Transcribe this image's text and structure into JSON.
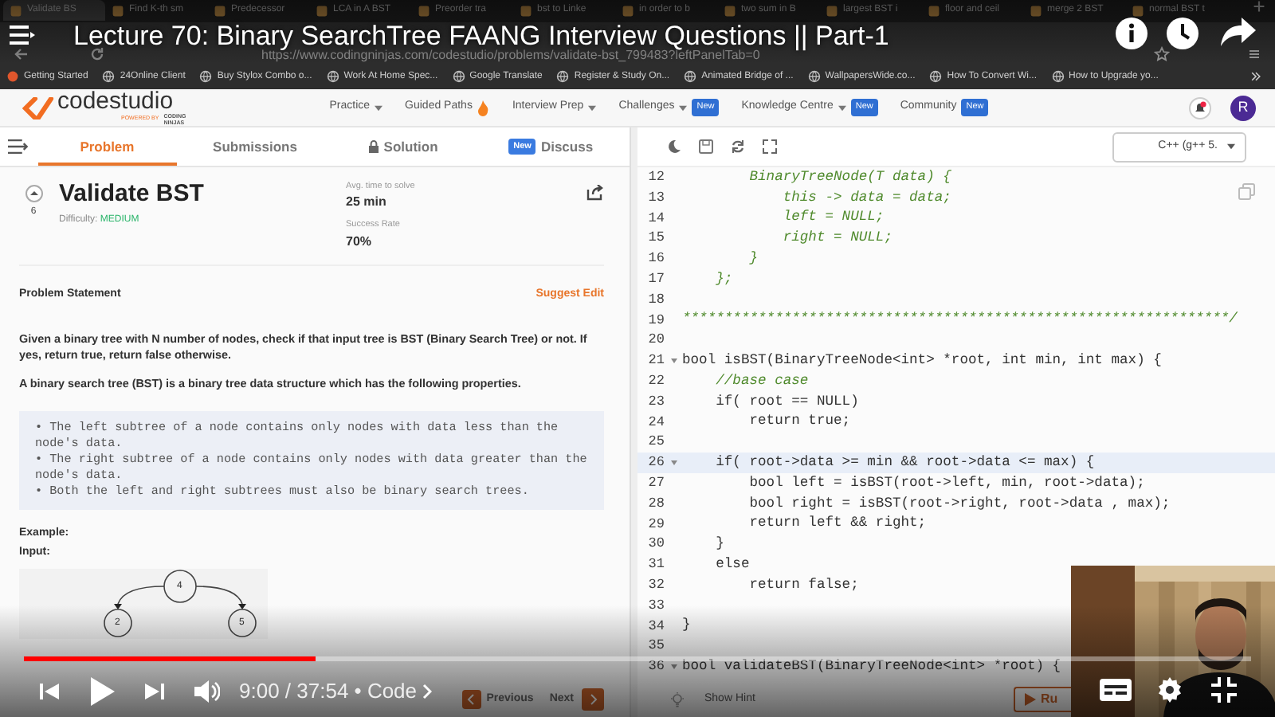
{
  "video": {
    "title": "Lecture 70: Binary SearchTree FAANG Interview Questions || Part-1",
    "progress": {
      "level": 0.238
    },
    "time": "9:00 / 37:54 • Code"
  },
  "browser": {
    "tabs": [
      {
        "label": "Validate BS",
        "selected": true
      },
      {
        "label": "Find K-th sm",
        "selected": false
      },
      {
        "label": "Predecessor",
        "selected": false
      },
      {
        "label": "LCA in A BST",
        "selected": false
      },
      {
        "label": "Preorder tra",
        "selected": false
      },
      {
        "label": "bst to Linke",
        "selected": false
      },
      {
        "label": "in order to b",
        "selected": false
      },
      {
        "label": "two sum in B",
        "selected": false
      },
      {
        "label": "largest BST i",
        "selected": false
      },
      {
        "label": "floor and ceil",
        "selected": false
      },
      {
        "label": "merge 2 BST",
        "selected": false
      },
      {
        "label": "normal BST t",
        "selected": false
      }
    ],
    "url": "https://www.codingninjas.com/codestudio/problems/validate-bst_799483?leftPanelTab=0",
    "bookmarks": [
      "Getting Started",
      "24Online Client",
      "Buy Stylox Combo o...",
      "Work At Home Spec...",
      "Google Translate",
      "Register & Study On...",
      "Animated Bridge of ...",
      "WallpapersWide.co...",
      "How To Convert Wi...",
      "How to Upgrade yo..."
    ]
  },
  "site": {
    "logo": "codestudio",
    "powered_by": "POWERED BY",
    "brand": "CODING NINJAS",
    "nav": [
      {
        "label": "Practice",
        "kind": "dropdown"
      },
      {
        "label": "Guided Paths",
        "kind": "fire"
      },
      {
        "label": "Interview Prep",
        "kind": "dropdown"
      },
      {
        "label": "Challenges",
        "kind": "dropdown",
        "badge": "New"
      },
      {
        "label": "Knowledge Centre",
        "kind": "dropdown",
        "badge": "New"
      },
      {
        "label": "Community",
        "kind": "plain",
        "badge": "New"
      }
    ],
    "avatar": "R"
  },
  "panel_tabs": [
    {
      "label": "Problem",
      "selected": true,
      "kind": "plain"
    },
    {
      "label": "Submissions",
      "selected": false,
      "kind": "plain"
    },
    {
      "label": "Solution",
      "selected": false,
      "kind": "locked"
    },
    {
      "label": "Discuss",
      "selected": false,
      "kind": "badge",
      "badge": "New"
    }
  ],
  "problem": {
    "votes": "6",
    "title": "Validate BST",
    "difficulty_label": "Difficulty:",
    "difficulty": "MEDIUM",
    "stats": [
      {
        "label": "Avg. time to solve",
        "value": "25 min"
      },
      {
        "label": "Success Rate",
        "value": "70%"
      }
    ],
    "statement_heading": "Problem Statement",
    "suggest_edit": "Suggest Edit",
    "paragraphs": [
      "Given a binary tree with N number of nodes, check if that input tree is BST (Binary Search Tree) or not. If yes, return true, return false otherwise.",
      "A binary search tree (BST) is a binary tree data structure which has the following properties."
    ],
    "bullets": [
      "• The left subtree of a node contains only nodes with data less than the node's data.",
      "• The right subtree of a node contains only nodes with data greater than the node's data.",
      "• Both the left and right subtrees must also be binary search trees."
    ],
    "example": "Example:",
    "input": "Input:",
    "tree": [
      {
        "label": "4"
      },
      {
        "label": "2"
      },
      {
        "label": "5"
      }
    ]
  },
  "editor": {
    "language": "C++ (g++ 5.",
    "lines": [
      {
        "number": "12",
        "code": "        BinaryTreeNode(T data) {",
        "kind": "comment",
        "foldable": false,
        "highlighted": false
      },
      {
        "number": "13",
        "code": "            this -> data = data;",
        "kind": "comment",
        "foldable": false,
        "highlighted": false
      },
      {
        "number": "14",
        "code": "            left = NULL;",
        "kind": "comment",
        "foldable": false,
        "highlighted": false
      },
      {
        "number": "15",
        "code": "            right = NULL;",
        "kind": "comment",
        "foldable": false,
        "highlighted": false
      },
      {
        "number": "16",
        "code": "        }",
        "kind": "comment",
        "foldable": false,
        "highlighted": false
      },
      {
        "number": "17",
        "code": "    };",
        "kind": "comment",
        "foldable": false,
        "highlighted": false
      },
      {
        "number": "18",
        "foldable": false,
        "highlighted": false
      },
      {
        "number": "19",
        "code": "*****************************************************************/",
        "kind": "comment",
        "foldable": false,
        "highlighted": false
      },
      {
        "number": "20",
        "foldable": false,
        "highlighted": false
      },
      {
        "number": "21",
        "code": "bool isBST(BinaryTreeNode<int> *root, int min, int max) {",
        "kind": "code",
        "foldable": true,
        "highlighted": false
      },
      {
        "number": "22",
        "code": "    //base case",
        "kind": "comment",
        "foldable": false,
        "highlighted": false
      },
      {
        "number": "23",
        "code": "    if( root == NULL)",
        "kind": "code",
        "foldable": false,
        "highlighted": false
      },
      {
        "number": "24",
        "code": "        return true;",
        "kind": "code",
        "foldable": false,
        "highlighted": false
      },
      {
        "number": "25",
        "foldable": false,
        "highlighted": false
      },
      {
        "number": "26",
        "code": "    if( root->data >= min && root->data <= max) {",
        "kind": "code",
        "foldable": true,
        "highlighted": true
      },
      {
        "number": "27",
        "code": "        bool left = isBST(root->left, min, root->data);",
        "kind": "code",
        "foldable": false,
        "highlighted": false
      },
      {
        "number": "28",
        "code": "        bool right = isBST(root->right, root->data , max);",
        "kind": "code",
        "foldable": false,
        "highlighted": false
      },
      {
        "number": "29",
        "code": "        return left && right;",
        "kind": "code",
        "foldable": false,
        "highlighted": false
      },
      {
        "number": "30",
        "code": "    }",
        "kind": "code",
        "foldable": false,
        "highlighted": false
      },
      {
        "number": "31",
        "code": "    else",
        "kind": "code",
        "foldable": false,
        "highlighted": false
      },
      {
        "number": "32",
        "code": "        return false;",
        "kind": "code",
        "foldable": false,
        "highlighted": false
      },
      {
        "number": "33",
        "foldable": false,
        "highlighted": false
      },
      {
        "number": "34",
        "code": "}",
        "kind": "code",
        "foldable": false,
        "highlighted": false
      },
      {
        "number": "35",
        "foldable": false,
        "highlighted": false
      },
      {
        "number": "36",
        "code": "bool validateBST(BinaryTreeNode<int> *root) {",
        "kind": "code",
        "foldable": true,
        "highlighted": false
      }
    ]
  },
  "footer": {
    "previous": "Previous",
    "next": "Next",
    "hint": "Show Hint",
    "run": "Ru"
  }
}
